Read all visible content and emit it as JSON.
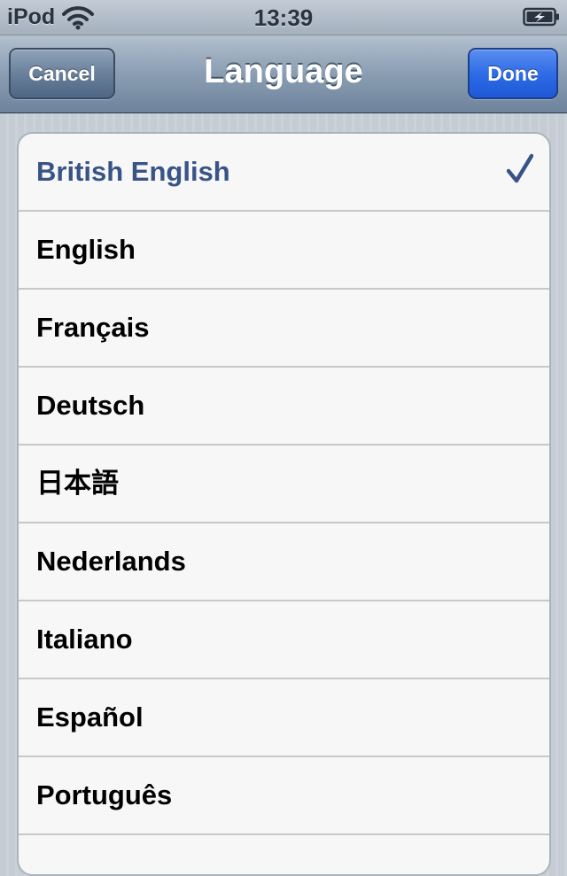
{
  "status_bar": {
    "carrier": "iPod",
    "time": "13:39",
    "wifi_icon": "wifi-icon",
    "battery_icon": "battery-charging-icon"
  },
  "nav_bar": {
    "title": "Language",
    "cancel_label": "Cancel",
    "done_label": "Done",
    "done_color": "#2f6ce6"
  },
  "languages": {
    "selected_color": "#385487",
    "check_icon": "checkmark-icon",
    "items": [
      {
        "label": "British English",
        "selected": true
      },
      {
        "label": "English",
        "selected": false
      },
      {
        "label": "Français",
        "selected": false
      },
      {
        "label": "Deutsch",
        "selected": false
      },
      {
        "label": "日本語",
        "selected": false
      },
      {
        "label": "Nederlands",
        "selected": false
      },
      {
        "label": "Italiano",
        "selected": false
      },
      {
        "label": "Español",
        "selected": false
      },
      {
        "label": "Português",
        "selected": false
      },
      {
        "label": "",
        "selected": false
      }
    ]
  }
}
